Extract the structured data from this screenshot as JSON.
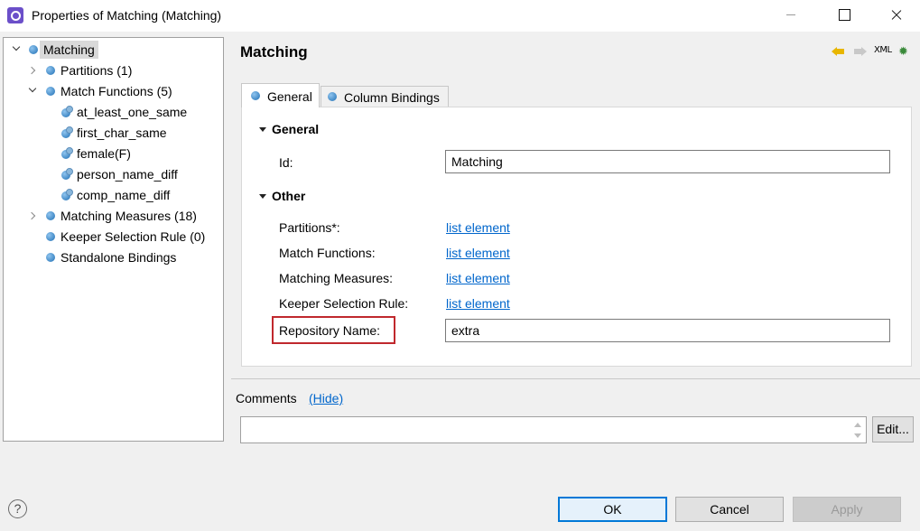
{
  "window": {
    "title": "Properties of Matching (Matching)"
  },
  "tree": {
    "items": [
      {
        "label": "Matching",
        "selected": true
      },
      {
        "label": "Partitions (1)"
      },
      {
        "label": "Match Functions (5)"
      },
      {
        "label": "at_least_one_same"
      },
      {
        "label": "first_char_same"
      },
      {
        "label": "female(F)"
      },
      {
        "label": "person_name_diff"
      },
      {
        "label": "comp_name_diff"
      },
      {
        "label": "Matching Measures (18)"
      },
      {
        "label": "Keeper Selection Rule (0)"
      },
      {
        "label": "Standalone Bindings"
      }
    ]
  },
  "header": {
    "title": "Matching",
    "xml_label": "XML"
  },
  "tabs": [
    {
      "label": "General",
      "active": true
    },
    {
      "label": "Column Bindings"
    }
  ],
  "general_section": {
    "title": "General",
    "id_label": "Id:",
    "id_value": "Matching"
  },
  "other_section": {
    "title": "Other",
    "rows": [
      {
        "label": "Partitions*:",
        "link": "list element"
      },
      {
        "label": "Match Functions:",
        "link": "list element"
      },
      {
        "label": "Matching Measures:",
        "link": "list element"
      },
      {
        "label": "Keeper Selection Rule:",
        "link": "list element"
      }
    ],
    "repository_label": "Repository Name:",
    "repository_value": "extra"
  },
  "comments": {
    "label": "Comments",
    "hide_link": "(Hide)",
    "value": "",
    "edit_label": "Edit..."
  },
  "footer": {
    "help": "?",
    "ok": "OK",
    "cancel": "Cancel",
    "apply": "Apply"
  },
  "colors": {
    "accent": "#0078d7",
    "link": "#0066cc",
    "highlight_box": "#c0282d"
  }
}
